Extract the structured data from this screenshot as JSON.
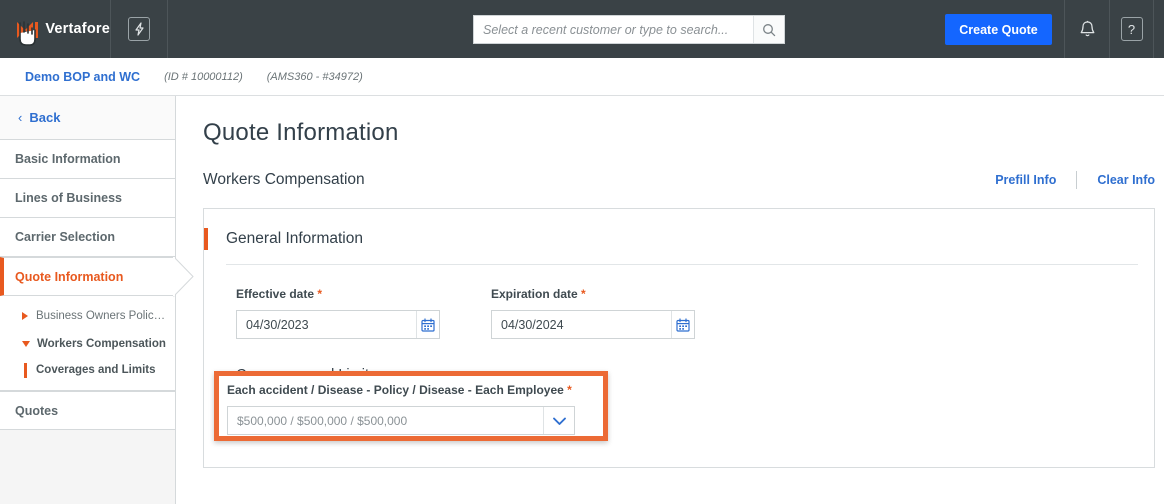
{
  "header": {
    "brand_name": "Vertafore",
    "brand_mark_icon": "vertafore-logo-icon",
    "cursor_icon": "hand-cursor-icon",
    "bolt_icon": "lightning-bolt-icon",
    "search": {
      "placeholder": "Select a recent customer or type to search...",
      "value": "",
      "search_icon": "search-icon"
    },
    "create_quote_label": "Create Quote",
    "bell_icon": "bell-icon",
    "help_label": "?",
    "help_icon": "question-mark-icon",
    "bg_color": "#3a4246",
    "accent_blue": "#1466ff"
  },
  "breadcrumb": {
    "account_name": "Demo BOP and WC",
    "account_id": "(ID # 10000112)",
    "system_ref": "(AMS360 - #34972)"
  },
  "sidebar": {
    "back_label": "Back",
    "back_icon": "chevron-left-icon",
    "items": [
      {
        "label": "Basic Information",
        "active": false
      },
      {
        "label": "Lines of Business",
        "active": false
      },
      {
        "label": "Carrier Selection",
        "active": false
      },
      {
        "label": "Quote Information",
        "active": true
      }
    ],
    "sub_items": [
      {
        "label": "Business Owners Polic…",
        "state": "collapsed",
        "icon": "triangle-right-icon"
      },
      {
        "label": "Workers Compensation",
        "state": "expanded",
        "icon": "triangle-down-icon"
      },
      {
        "label": "Coverages and Limits",
        "state": "selected",
        "icon": "active-bar-icon"
      }
    ],
    "footer_item": {
      "label": "Quotes"
    },
    "active_color": "#e8591f"
  },
  "main": {
    "page_title": "Quote Information",
    "sub_title": "Workers Compensation",
    "prefill_link": "Prefill Info",
    "clear_link": "Clear Info",
    "card": {
      "title": "General Information",
      "effective": {
        "label": "Effective date",
        "required": "*",
        "value": "04/30/2023",
        "calendar_icon": "calendar-icon"
      },
      "expiration": {
        "label": "Expiration date",
        "required": "*",
        "value": "04/30/2024",
        "calendar_icon": "calendar-icon"
      },
      "coverages_title": "Coverages and Limits",
      "limit_field": {
        "label": "Each accident / Disease - Policy / Disease - Each Employee",
        "required": "*",
        "value": "$500,000 / $500,000 / $500,000",
        "chevron_icon": "chevron-down-icon",
        "highlight_color": "#ec6a35"
      }
    }
  }
}
